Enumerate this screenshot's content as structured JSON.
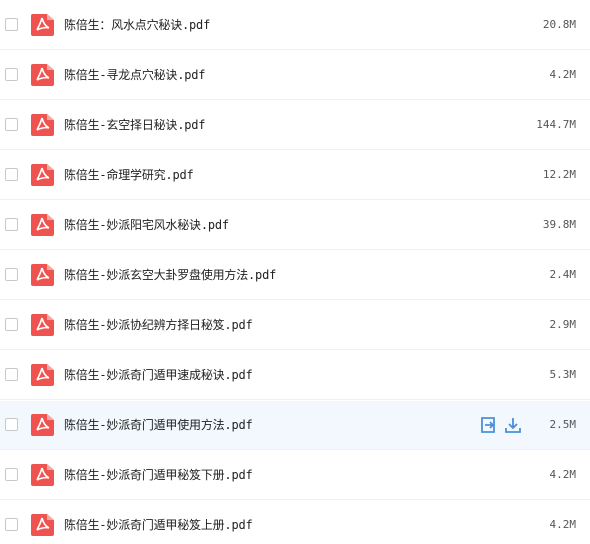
{
  "files": [
    {
      "name": "陈倍生：风水点穴秘诀.pdf",
      "size": "20.8M"
    },
    {
      "name": "陈倍生-寻龙点穴秘诀.pdf",
      "size": "4.2M"
    },
    {
      "name": "陈倍生-玄空择日秘诀.pdf",
      "size": "144.7M"
    },
    {
      "name": "陈倍生-命理学研究.pdf",
      "size": "12.2M"
    },
    {
      "name": "陈倍生-妙派阳宅风水秘诀.pdf",
      "size": "39.8M"
    },
    {
      "name": "陈倍生-妙派玄空大卦罗盘使用方法.pdf",
      "size": "2.4M"
    },
    {
      "name": "陈倍生-妙派协纪辨方择日秘笈.pdf",
      "size": "2.9M"
    },
    {
      "name": "陈倍生-妙派奇门遁甲速成秘诀.pdf",
      "size": "5.3M"
    },
    {
      "name": "陈倍生-妙派奇门遁甲使用方法.pdf",
      "size": "2.5M"
    },
    {
      "name": "陈倍生-妙派奇门遁甲秘笈下册.pdf",
      "size": "4.2M"
    },
    {
      "name": "陈倍生-妙派奇门遁甲秘笈上册.pdf",
      "size": "4.2M"
    }
  ],
  "hovered_row": 8,
  "icons": {
    "file": "pdf-file-icon",
    "move": "move-to-icon",
    "download": "download-icon"
  },
  "colors": {
    "pdf_icon": "#ef5350",
    "action_icon": "#4a90d9",
    "hover_bg": "#f3f8fe"
  }
}
